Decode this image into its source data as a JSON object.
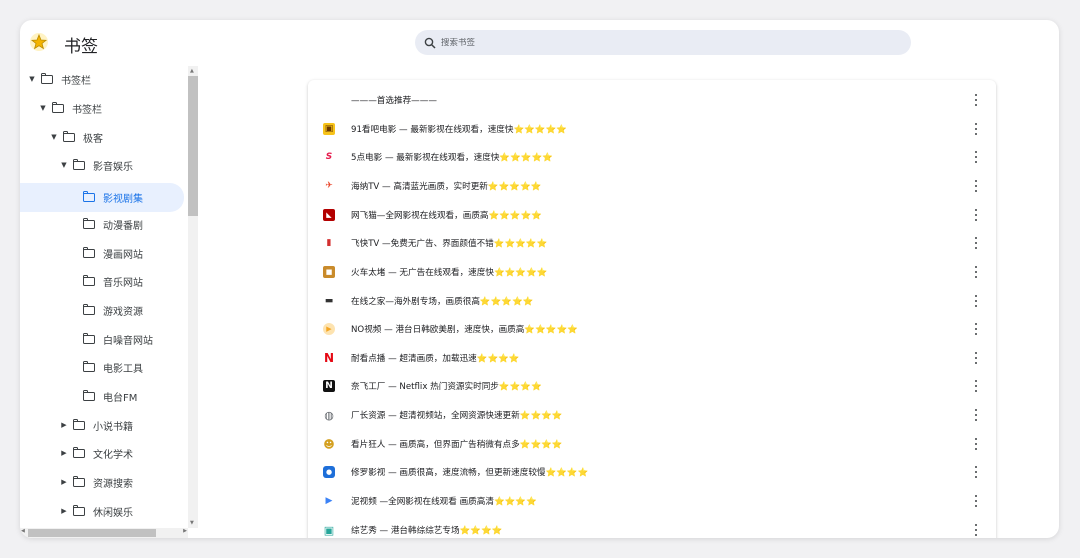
{
  "app": {
    "title": "书签"
  },
  "search": {
    "placeholder": "搜索书签"
  },
  "sidebar": {
    "items": [
      {
        "label": "书签栏",
        "expanded": true
      },
      {
        "label": "书签栏",
        "expanded": true
      },
      {
        "label": "极客",
        "expanded": true
      },
      {
        "label": "影音娱乐",
        "expanded": true
      },
      {
        "label": "影视剧集",
        "selected": true
      },
      {
        "label": "动漫番剧"
      },
      {
        "label": "漫画网站"
      },
      {
        "label": "音乐网站"
      },
      {
        "label": "游戏资源"
      },
      {
        "label": "白噪音网站"
      },
      {
        "label": "电影工具"
      },
      {
        "label": "电台FM"
      },
      {
        "label": "小说书籍",
        "expanded": false
      },
      {
        "label": "文化学术",
        "expanded": false
      },
      {
        "label": "资源搜索",
        "expanded": false
      },
      {
        "label": "休闲娱乐",
        "expanded": false
      }
    ]
  },
  "bookmarks": [
    {
      "title": "———首选推荐———",
      "icon": "none"
    },
    {
      "title": "91看吧电影 — 最新影视在线观看，速度快⭐⭐⭐⭐⭐",
      "icon": "film-popcorn-icon",
      "color": "#f7c31a"
    },
    {
      "title": "5点电影 — 最新影视在线观看，速度快⭐⭐⭐⭐⭐",
      "icon": "s-logo-icon",
      "color": "#e6194b"
    },
    {
      "title": "海纳TV — 高清蓝光画质，实时更新⭐⭐⭐⭐⭐",
      "icon": "bird-logo-icon",
      "color": "#e8462b"
    },
    {
      "title": "网飞猫—全网影视在线观看，画质高⭐⭐⭐⭐⭐",
      "icon": "cat-logo-icon",
      "color": "#b30000"
    },
    {
      "title": "飞快TV —免费无广告、界面颜值不错⭐⭐⭐⭐⭐",
      "icon": "fk-logo-icon",
      "color": "#d32f2f"
    },
    {
      "title": "火车太堵 — 无广告在线观看，速度快⭐⭐⭐⭐⭐",
      "icon": "train-logo-icon",
      "color": "#c98b2b"
    },
    {
      "title": "在线之家—海外剧专场，画质很高⭐⭐⭐⭐⭐",
      "icon": "clapper-icon",
      "color": "#333333"
    },
    {
      "title": "NO视频 — 港台日韩欧美剧，速度快，画质高⭐⭐⭐⭐⭐",
      "icon": "play-circle-icon",
      "color": "#f5a623"
    },
    {
      "title": "耐看点播 — 超清画质，加载迅速⭐⭐⭐⭐",
      "icon": "n-logo-icon",
      "color": "#e50914"
    },
    {
      "title": "奈飞工厂 — Netflix 热门资源实时同步⭐⭐⭐⭐",
      "icon": "n-box-logo-icon",
      "color": "#111111"
    },
    {
      "title": "厂长资源 — 超清视频站，全网资源快速更新⭐⭐⭐⭐",
      "icon": "globe-icon",
      "color": "#5f6368"
    },
    {
      "title": "看片狂人 — 画质高，但界面广告稍微有点多⭐⭐⭐⭐",
      "icon": "mascot-icon",
      "color": "#d4a020"
    },
    {
      "title": "修罗影视 — 画质很高，速度流畅，但更新速度较慢⭐⭐⭐⭐",
      "icon": "tv-logo-icon",
      "color": "#1e6fd9"
    },
    {
      "title": "泥视频 —全网影视在线观看 画质高清⭐⭐⭐⭐",
      "icon": "play-triangle-icon",
      "color": "#3b82f6"
    },
    {
      "title": "综艺秀 — 港台韩综综艺专场⭐⭐⭐⭐",
      "icon": "frame-logo-icon",
      "color": "#26a69a"
    }
  ]
}
